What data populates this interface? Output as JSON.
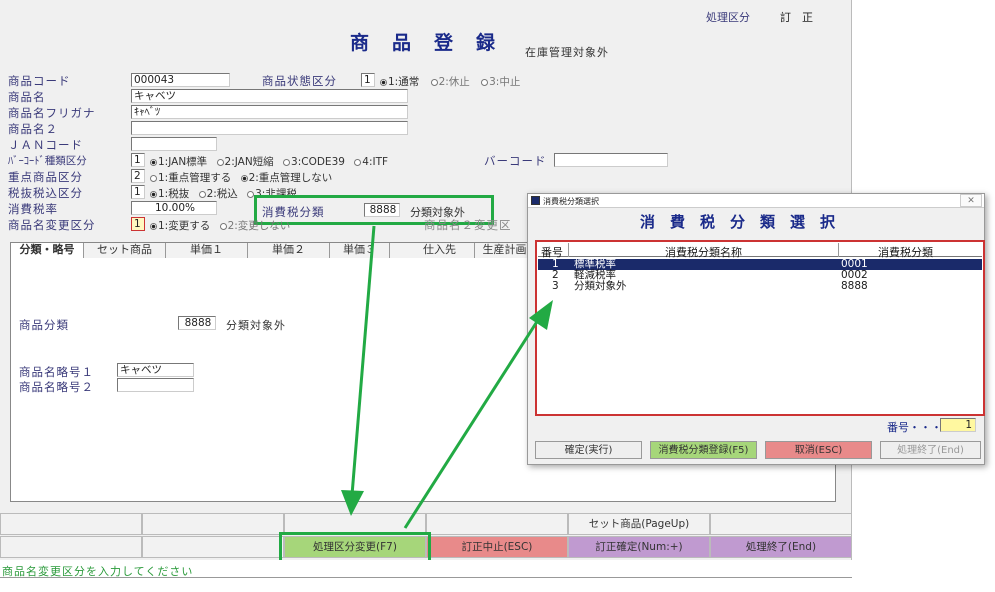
{
  "header": {
    "mode_label": "処理区分",
    "mode_value": "訂　正",
    "title": "商　品　登　録",
    "subtitle": "在庫管理対象外"
  },
  "form": {
    "product_code": {
      "label": "商品コード",
      "value": "000043"
    },
    "status": {
      "label": "商品状態区分",
      "value": "1",
      "opt1": "1:通常",
      "opt2": "2:休止",
      "opt3": "3:中止"
    },
    "name": {
      "label": "商品名",
      "value": "キャベツ"
    },
    "kana": {
      "label": "商品名フリガナ",
      "value": "ｷｬﾍﾞﾂ"
    },
    "name2": {
      "label": "商品名２",
      "value": ""
    },
    "jan": {
      "label": "ＪＡＮコード",
      "value": ""
    },
    "barcode_type": {
      "label": "ﾊﾞｰｺｰﾄﾞ種類区分",
      "value": "1",
      "opt1": "1:JAN標準",
      "opt2": "2:JAN短縮",
      "opt3": "3:CODE39",
      "opt4": "4:ITF"
    },
    "barcode": {
      "label": "バーコード",
      "value": ""
    },
    "priority": {
      "label": "重点商品区分",
      "value": "2",
      "opt1": "1:重点管理する",
      "opt2": "2:重点管理しない"
    },
    "tax_incl": {
      "label": "税抜税込区分",
      "value": "1",
      "opt1": "1:税抜",
      "opt2": "2:税込",
      "opt3": "3:非課税"
    },
    "tax_rate": {
      "label": "消費税率",
      "value": "10.00%"
    },
    "tax_class": {
      "label": "消費税分類",
      "value": "8888",
      "text": "分類対象外"
    },
    "name_change": {
      "label": "商品名変更区分",
      "value": "1",
      "opt1": "1:変更する",
      "opt2": "2:変更しない"
    },
    "name_change_extra": "商品名２変更区"
  },
  "tabs": [
    "分類・略号",
    "セット商品",
    "単価１",
    "単価２",
    "単価３",
    "仕入先",
    "生産計画"
  ],
  "tab_panel": {
    "category": {
      "label": "商品分類",
      "value": "8888",
      "text": "分類対象外"
    },
    "abbr1": {
      "label": "商品名略号１",
      "value": "キャベツ"
    },
    "abbr2": {
      "label": "商品名略号２",
      "value": ""
    }
  },
  "buttons_row1": {
    "set": "セット商品(PageUp)"
  },
  "buttons_row2": {
    "mode": "処理区分変更(F7)",
    "cancel": "訂正中止(ESC)",
    "confirm": "訂正確定(Num:+)",
    "end": "処理終了(End)"
  },
  "status_bar": "商品名変更区分を入力してください",
  "dialog": {
    "window_title": "消費税分類選択",
    "heading": "消　費　税　分　類　選　択",
    "columns": [
      "番号",
      "消費税分類名称",
      "消費税分類"
    ],
    "rows": [
      [
        "1",
        "標準税率",
        "0001"
      ],
      [
        "2",
        "軽減税率",
        "0002"
      ],
      [
        "3",
        "分類対象外",
        "8888"
      ]
    ],
    "number_label": "番号・・・",
    "number_value": "1",
    "buttons": {
      "ok": "確定(実行)",
      "register": "消費税分類登録(F5)",
      "cancel": "取消(ESC)",
      "end": "処理終了(End)"
    }
  },
  "colors": {
    "highlight": "#22aa44",
    "selected_row": "#1a2a6a",
    "btn_green": "#a6d67a",
    "btn_red": "#e88a8a",
    "btn_purple": "#c09ad0",
    "dialog_title": "#1a2a8a"
  }
}
